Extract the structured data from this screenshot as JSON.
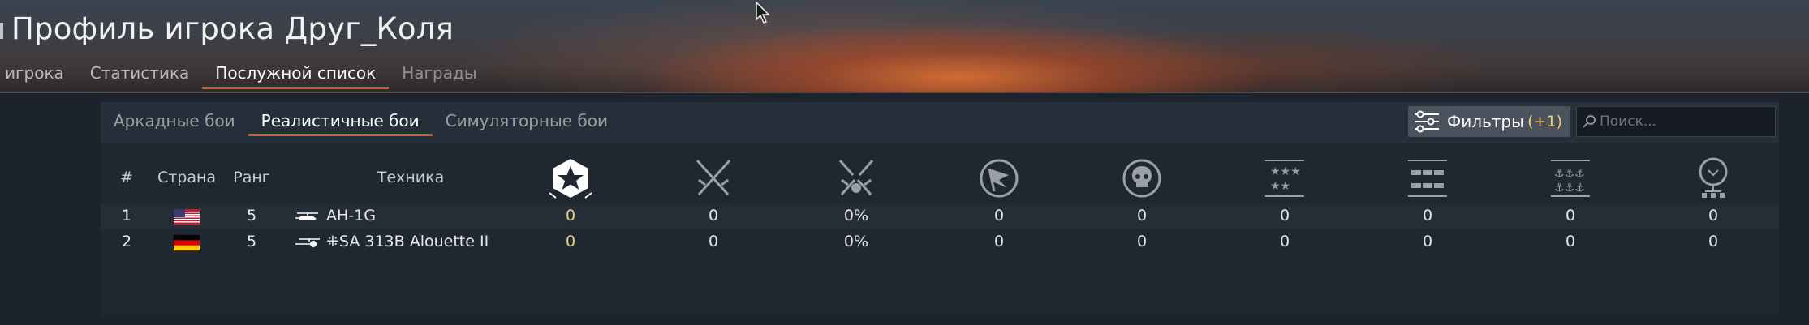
{
  "header": {
    "title": "Профиль игрока Друг_Коля",
    "tabs": [
      {
        "label": "игрока",
        "state": "normal"
      },
      {
        "label": "Статистика",
        "state": "normal"
      },
      {
        "label": "Послужной список",
        "state": "active"
      },
      {
        "label": "Награды",
        "state": "muted"
      }
    ]
  },
  "mode_tabs": [
    {
      "label": "Аркадные бои",
      "state": "normal"
    },
    {
      "label": "Реалистичные бои",
      "state": "active"
    },
    {
      "label": "Симуляторные бои",
      "state": "normal"
    }
  ],
  "filters": {
    "label": "Фильтры",
    "count": "(+1)"
  },
  "search": {
    "placeholder": "Поиск...",
    "value": ""
  },
  "table": {
    "columns": {
      "index": "#",
      "country": "Страна",
      "rank": "Ранг",
      "vehicle": "Техника"
    },
    "stat_icons": [
      "star-emblem-icon",
      "crossed-swords-icon",
      "broken-swords-icon",
      "flag-capture-icon",
      "skull-icon",
      "stars-row-icon",
      "ground-units-icon",
      "naval-anchors-icon",
      "balloon-icon"
    ],
    "rows": [
      {
        "index": "1",
        "country": "usa-flag-icon",
        "rank": "5",
        "vehicle_icon": "helicopter-icon",
        "vehicle": "AH-1G",
        "stats": [
          "0",
          "0",
          "0%",
          "0",
          "0",
          "0",
          "0",
          "0",
          "0"
        ]
      },
      {
        "index": "2",
        "country": "germany-flag-icon",
        "rank": "5",
        "vehicle_icon": "helicopter-icon",
        "vehicle": "⁜SA 313B Alouette II",
        "stats": [
          "0",
          "0",
          "0%",
          "0",
          "0",
          "0",
          "0",
          "0",
          "0"
        ]
      }
    ]
  },
  "colors": {
    "accent_underline": "#cf5b2f",
    "highlight_value": "#f0d27a",
    "filter_count": "#f4cf62"
  }
}
